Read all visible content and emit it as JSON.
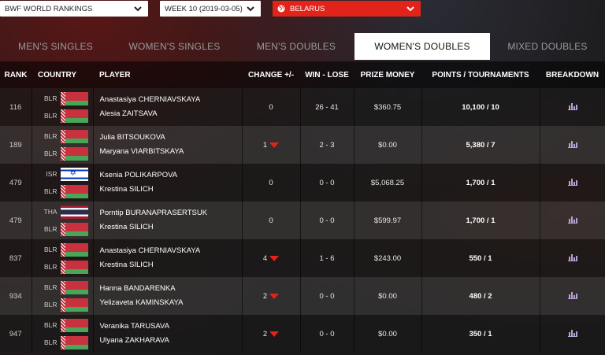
{
  "filters": {
    "ranking": "BWF WORLD RANKINGS",
    "week": "WEEK 10 (2019-03-05)",
    "country": "BELARUS"
  },
  "tabs": [
    {
      "label": "MEN'S SINGLES",
      "active": false
    },
    {
      "label": "WOMEN'S SINGLES",
      "active": false
    },
    {
      "label": "MEN'S DOUBLES",
      "active": false
    },
    {
      "label": "WOMEN'S DOUBLES",
      "active": true
    },
    {
      "label": "MIXED DOUBLES",
      "active": false
    }
  ],
  "columns": {
    "rank": "RANK",
    "country": "COUNTRY",
    "player": "PLAYER",
    "change": "CHANGE +/-",
    "winlose": "WIN - LOSE",
    "prize": "PRIZE MONEY",
    "points": "POINTS / TOURNAMENTS",
    "breakdown": "BREAKDOWN"
  },
  "colors": {
    "accent": "#e2231a",
    "tab_active_bg": "#ffffff"
  },
  "rows": [
    {
      "rank": "116",
      "c1": "BLR",
      "c2": "BLR",
      "f1": "blr",
      "f2": "blr",
      "p1": "Anastasiya CHERNIAVSKAYA",
      "p2": "Alesia ZAITSAVA",
      "change": "0",
      "down": false,
      "winlose": "26 - 41",
      "prize": "$360.75",
      "points": "10,100 / 10"
    },
    {
      "rank": "189",
      "c1": "BLR",
      "c2": "BLR",
      "f1": "blr",
      "f2": "blr",
      "p1": "Julia BITSOUKOVA",
      "p2": "Maryana VIARBITSKAYA",
      "change": "1",
      "down": true,
      "winlose": "2 - 3",
      "prize": "$0.00",
      "points": "5,380 / 7"
    },
    {
      "rank": "479",
      "c1": "ISR",
      "c2": "BLR",
      "f1": "isr",
      "f2": "blr",
      "p1": "Ksenia POLIKARPOVA",
      "p2": "Krestina SILICH",
      "change": "0",
      "down": false,
      "winlose": "0 - 0",
      "prize": "$5,068.25",
      "points": "1,700 / 1"
    },
    {
      "rank": "479",
      "c1": "THA",
      "c2": "BLR",
      "f1": "tha",
      "f2": "blr",
      "p1": "Porntip BURANAPRASERTSUK",
      "p2": "Krestina SILICH",
      "change": "0",
      "down": false,
      "winlose": "0 - 0",
      "prize": "$599.97",
      "points": "1,700 / 1"
    },
    {
      "rank": "837",
      "c1": "BLR",
      "c2": "BLR",
      "f1": "blr",
      "f2": "blr",
      "p1": "Anastasiya CHERNIAVSKAYA",
      "p2": "Krestina SILICH",
      "change": "4",
      "down": true,
      "winlose": "1 - 6",
      "prize": "$243.00",
      "points": "550 / 1"
    },
    {
      "rank": "934",
      "c1": "BLR",
      "c2": "BLR",
      "f1": "blr",
      "f2": "blr",
      "p1": "Hanna BANDARENKA",
      "p2": "Yelizaveta KAMINSKAYA",
      "change": "2",
      "down": true,
      "winlose": "0 - 0",
      "prize": "$0.00",
      "points": "480 / 2"
    },
    {
      "rank": "947",
      "c1": "BLR",
      "c2": "BLR",
      "f1": "blr",
      "f2": "blr",
      "p1": "Veranika TARUSAVA",
      "p2": "Ulyana ZAKHARAVA",
      "change": "2",
      "down": true,
      "winlose": "0 - 0",
      "prize": "$0.00",
      "points": "350 / 1"
    }
  ]
}
